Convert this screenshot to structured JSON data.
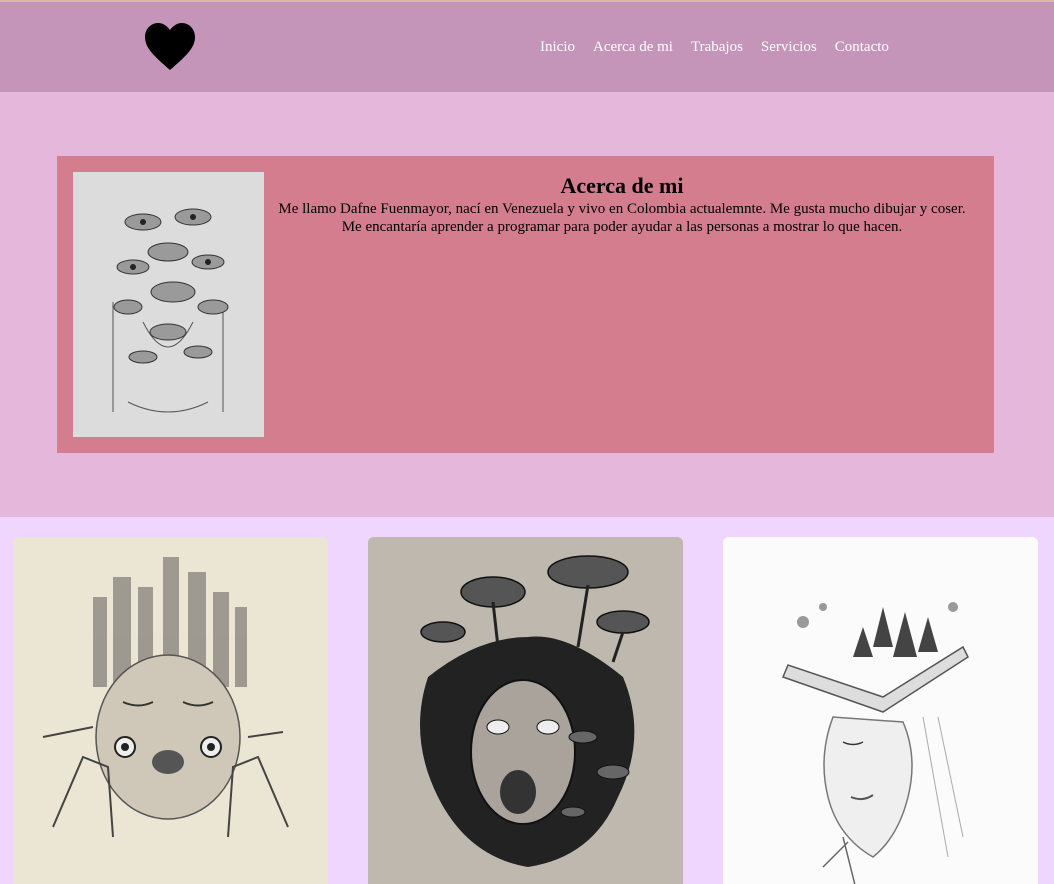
{
  "navbar": {
    "logo_icon": "heart-icon",
    "links": [
      "Inicio",
      "Acerca de mi",
      "Trabajos",
      "Servicios",
      "Contacto"
    ]
  },
  "about": {
    "title": "Acerca de mi",
    "body": "Me llamo Dafne Fuenmayor, nací en Venezuela y vivo en Colombia actualemnte. Me gusta mucho dibujar y coser. Me encantaría aprender a programar para poder ayudar a las personas a mostrar lo que hacen."
  },
  "colors": {
    "navbar_bg": "#c495b8",
    "about_section_bg": "#e5b7db",
    "about_card_bg": "#d47d8e",
    "gallery_bg": "#efd6ff"
  }
}
